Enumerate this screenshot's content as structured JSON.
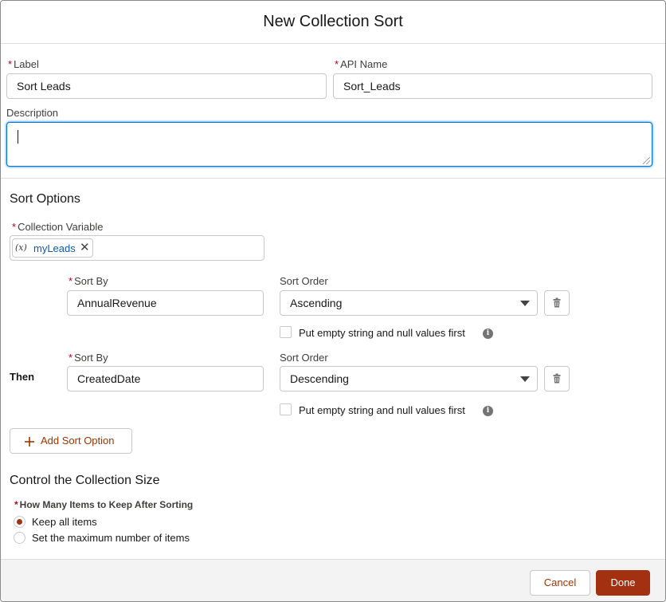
{
  "modal": {
    "title": "New Collection Sort"
  },
  "form": {
    "label": {
      "label": "Label",
      "value": "Sort Leads"
    },
    "api_name": {
      "label": "API Name",
      "value": "Sort_Leads"
    },
    "description": {
      "label": "Description",
      "value": ""
    }
  },
  "sort_options": {
    "title": "Sort Options",
    "collection_variable": {
      "label": "Collection Variable",
      "pill_icon": "variable-icon",
      "pill_icon_glyph": "(x)",
      "pill_value": "myLeads"
    },
    "then_label": "Then",
    "rows": [
      {
        "sort_by_label": "Sort By",
        "sort_by_value": "AnnualRevenue",
        "sort_order_label": "Sort Order",
        "sort_order_value": "Ascending",
        "nulls_first_label": "Put empty string and null values first",
        "nulls_first_checked": false
      },
      {
        "sort_by_label": "Sort By",
        "sort_by_value": "CreatedDate",
        "sort_order_label": "Sort Order",
        "sort_order_value": "Descending",
        "nulls_first_label": "Put empty string and null values first",
        "nulls_first_checked": false
      }
    ],
    "add_button_label": "Add Sort Option"
  },
  "collection_size": {
    "title": "Control the Collection Size",
    "question": "How Many Items to Keep After Sorting",
    "options": [
      {
        "label": "Keep all items",
        "checked": true
      },
      {
        "label": "Set the maximum number of items",
        "checked": false
      }
    ]
  },
  "footer": {
    "cancel_label": "Cancel",
    "done_label": "Done"
  },
  "colors": {
    "brand": "#a33010",
    "link": "#0b5cab",
    "focus": "#0176d3",
    "required": "#ba0517"
  }
}
